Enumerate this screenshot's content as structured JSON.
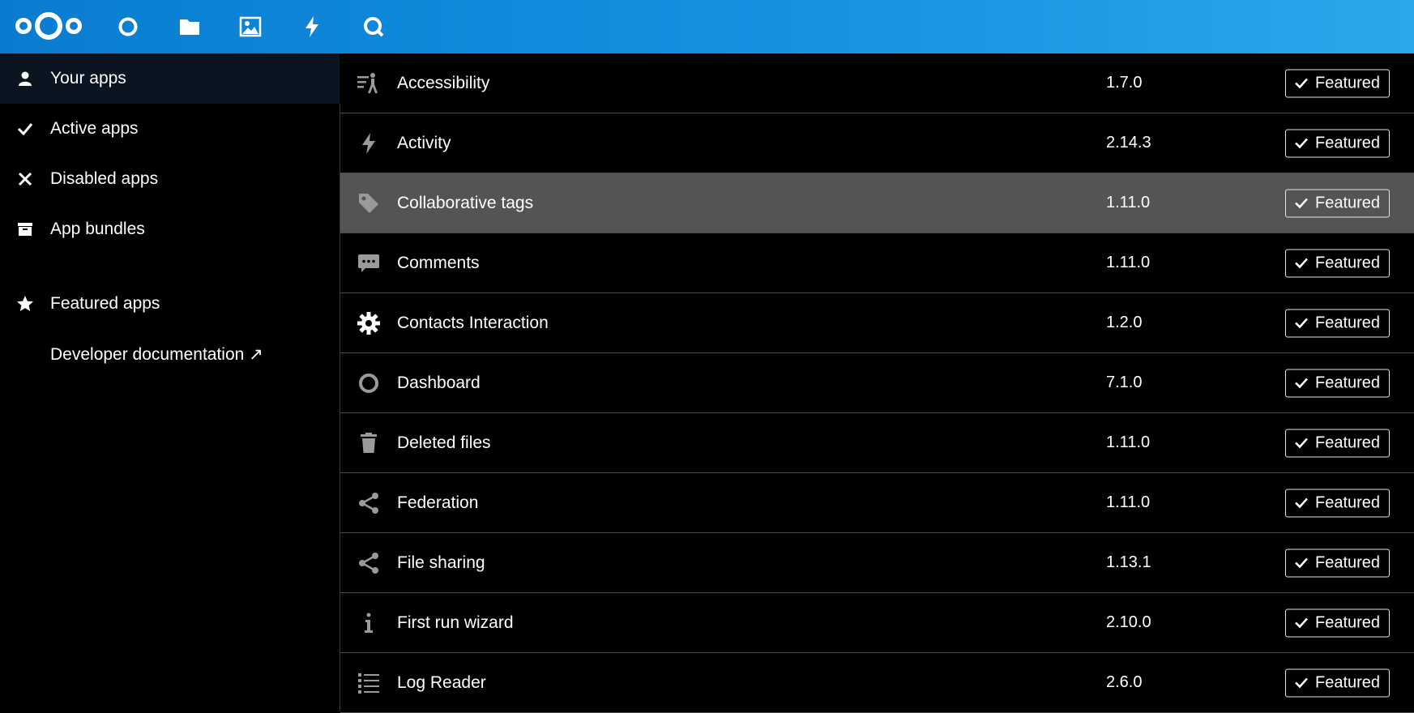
{
  "header": {
    "logo": "nextcloud-logo",
    "apps": [
      {
        "name": "dashboard-icon"
      },
      {
        "name": "files-icon"
      },
      {
        "name": "photos-icon"
      },
      {
        "name": "activity-icon"
      },
      {
        "name": "search-icon"
      }
    ]
  },
  "sidebar": {
    "items": [
      {
        "label": "Your apps",
        "icon": "user-icon",
        "active": true
      },
      {
        "label": "Active apps",
        "icon": "checkmark-icon"
      },
      {
        "label": "Disabled apps",
        "icon": "close-icon"
      },
      {
        "label": "App bundles",
        "icon": "archive-icon"
      },
      {
        "label": "Featured apps",
        "icon": "star-icon"
      },
      {
        "label": "Developer documentation ↗",
        "icon": ""
      }
    ]
  },
  "apps": [
    {
      "name": "Accessibility",
      "version": "1.7.0",
      "badge": "Featured",
      "icon": "accessibility-icon"
    },
    {
      "name": "Activity",
      "version": "2.14.3",
      "badge": "Featured",
      "icon": "activity-icon"
    },
    {
      "name": "Collaborative tags",
      "version": "1.11.0",
      "badge": "Featured",
      "icon": "tag-icon"
    },
    {
      "name": "Comments",
      "version": "1.11.0",
      "badge": "Featured",
      "icon": "comment-icon"
    },
    {
      "name": "Contacts Interaction",
      "version": "1.2.0",
      "badge": "Featured",
      "icon": "gear-icon"
    },
    {
      "name": "Dashboard",
      "version": "7.1.0",
      "badge": "Featured",
      "icon": "circle-icon"
    },
    {
      "name": "Deleted files",
      "version": "1.11.0",
      "badge": "Featured",
      "icon": "trash-icon"
    },
    {
      "name": "Federation",
      "version": "1.11.0",
      "badge": "Featured",
      "icon": "share-icon"
    },
    {
      "name": "File sharing",
      "version": "1.13.1",
      "badge": "Featured",
      "icon": "share-icon"
    },
    {
      "name": "First run wizard",
      "version": "2.10.0",
      "badge": "Featured",
      "icon": "info-icon"
    },
    {
      "name": "Log Reader",
      "version": "2.6.0",
      "badge": "Featured",
      "icon": "list-icon"
    }
  ],
  "colors": {
    "header_start": "#0a7cd0",
    "header_end": "#2aa6ec",
    "row_hover": "#545454",
    "icon_gray": "#9a9a9a"
  }
}
